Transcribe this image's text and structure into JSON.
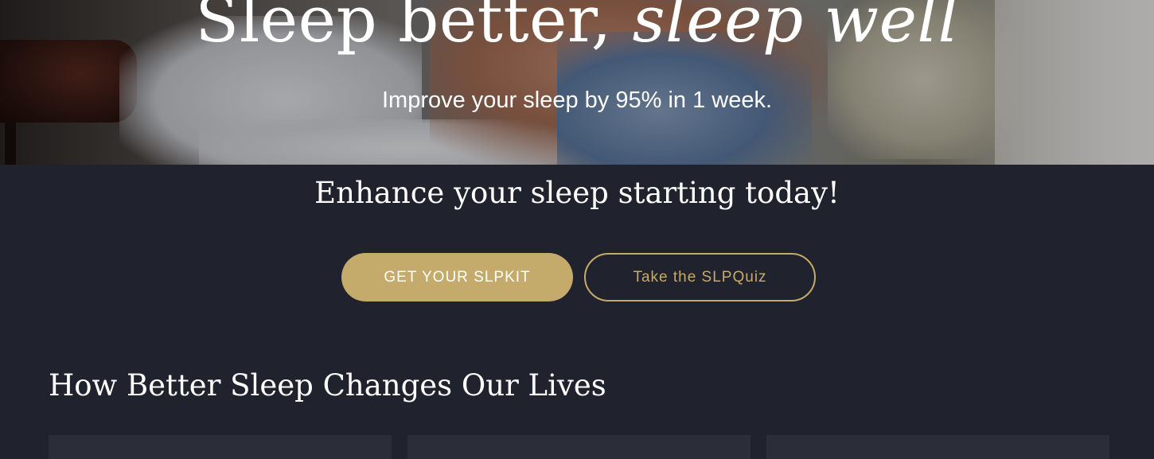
{
  "hero": {
    "title_regular": "Sleep better,",
    "title_italic": "sleep well",
    "subtitle": "Improve your sleep by 95% in 1 week."
  },
  "tagline": "Enhance your sleep starting today!",
  "buttons": {
    "primary_label": "GET YOUR SLPKIT",
    "secondary_label": "Take the SLPQuiz"
  },
  "section": {
    "title": "How Better Sleep Changes Our Lives"
  },
  "colors": {
    "background": "#20232d",
    "accent_gold": "#c5ab6b",
    "card": "#2b2e39",
    "text": "#ffffff"
  }
}
